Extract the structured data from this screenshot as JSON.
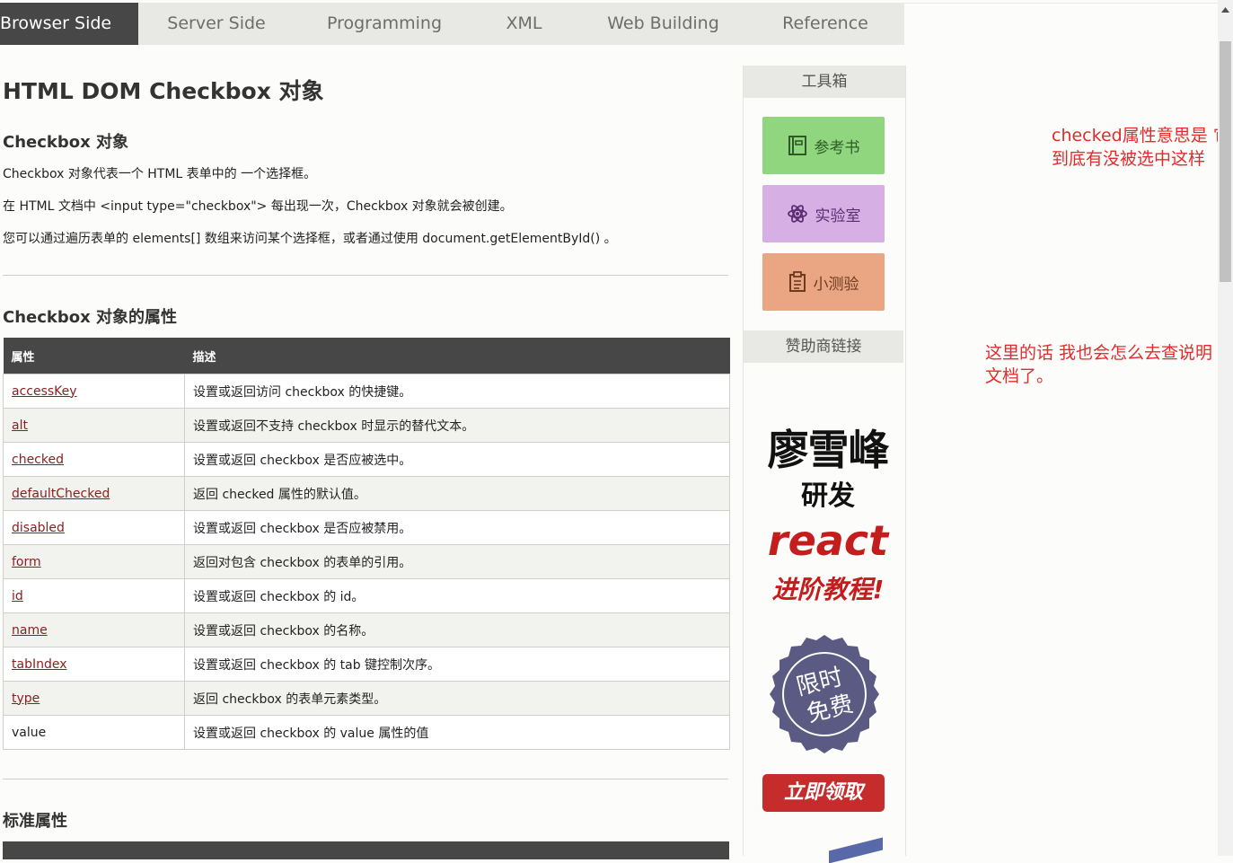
{
  "nav": {
    "items": [
      "Browser Side",
      "Server Side",
      "Programming",
      "XML",
      "Web Building",
      "Reference"
    ],
    "active": "Browser Side"
  },
  "main": {
    "title": "HTML DOM Checkbox 对象",
    "section1": {
      "heading": "Checkbox 对象",
      "p1": "Checkbox 对象代表一个 HTML 表单中的 一个选择框。",
      "p2": "在 HTML 文档中 <input type=\"checkbox\"> 每出现一次，Checkbox 对象就会被创建。",
      "p3": "您可以通过遍历表单的 elements[] 数组来访问某个选择框，或者通过使用 document.getElementById() 。"
    },
    "section2": {
      "heading": "Checkbox 对象的属性",
      "col_attr": "属性",
      "col_desc": "描述",
      "rows": [
        {
          "name": "accessKey",
          "desc": "设置或返回访问 checkbox 的快捷键。",
          "link": true
        },
        {
          "name": "alt",
          "desc": "设置或返回不支持 checkbox 时显示的替代文本。",
          "link": true
        },
        {
          "name": "checked",
          "desc": "设置或返回 checkbox 是否应被选中。",
          "link": true
        },
        {
          "name": "defaultChecked",
          "desc": "返回 checked 属性的默认值。",
          "link": true
        },
        {
          "name": "disabled",
          "desc": "设置或返回 checkbox 是否应被禁用。",
          "link": true
        },
        {
          "name": "form",
          "desc": "返回对包含 checkbox 的表单的引用。",
          "link": true
        },
        {
          "name": "id",
          "desc": "设置或返回 checkbox 的 id。",
          "link": true
        },
        {
          "name": "name",
          "desc": "设置或返回 checkbox 的名称。",
          "link": true
        },
        {
          "name": "tabIndex",
          "desc": "设置或返回 checkbox 的 tab 键控制次序。",
          "link": true
        },
        {
          "name": "type",
          "desc": "返回 checkbox 的表单元素类型。",
          "link": true
        },
        {
          "name": "value",
          "desc": "设置或返回 checkbox 的 value 属性的值",
          "link": false
        }
      ]
    },
    "section3": {
      "heading": "标准属性"
    }
  },
  "sidebar": {
    "toolbox_title": "工具箱",
    "buttons": {
      "reference": "参考书",
      "lab": "实验室",
      "quiz": "小测验"
    },
    "sponsor_title": "赞助商链接",
    "ad": {
      "name": "廖雪峰",
      "developed": "研发",
      "react": "react",
      "course": "进阶教程!",
      "seal_line1": "限时",
      "seal_line2": "免费",
      "cta": "立即领取"
    }
  },
  "annotations": {
    "note1": "checked属性意思是 它到底有没被选中这样",
    "note2": "这里的话 我也会怎么去查说明文档了。"
  },
  "colors": {
    "nav_bg": "#e8e8e4",
    "nav_active": "#474747",
    "link": "#8b2020",
    "annotation": "#e32b2b",
    "btn_reference": "#8fd67f",
    "btn_lab": "#d6b0e4",
    "btn_quiz": "#eaa583"
  }
}
